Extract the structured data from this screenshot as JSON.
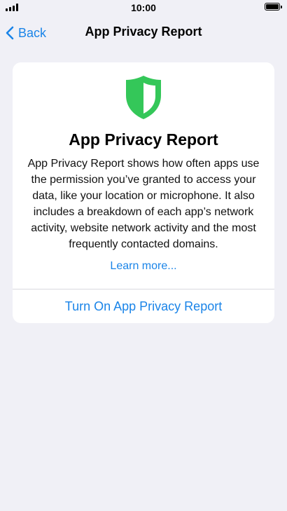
{
  "status_bar": {
    "time": "10:00",
    "signal_icon": "cellular-signal-icon",
    "battery_icon": "battery-icon"
  },
  "nav": {
    "back_label": "Back",
    "title": "App Privacy Report"
  },
  "card": {
    "icon": "shield-icon",
    "icon_colors": {
      "fill": "#34c759",
      "highlight": "#ffffff"
    },
    "title": "App Privacy Report",
    "description": "App Privacy Report shows how often apps use the permission you’ve granted to access your data, like your location or microphone. It also includes a breakdown of each app’s network activity, website network activity and the most frequently contacted domains.",
    "learn_more": "Learn more...",
    "action": "Turn On App Privacy Report"
  },
  "colors": {
    "accent": "#1a84e8",
    "background": "#f0f0f6",
    "card": "#ffffff"
  }
}
